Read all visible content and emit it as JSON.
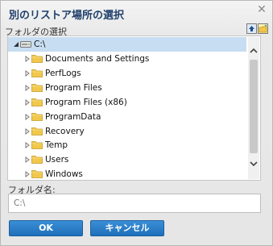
{
  "dialog": {
    "title": "別のリストア場所の選択",
    "folder_select_label": "フォルダの選択",
    "folder_name_label": "フォルダ名:",
    "folder_name_placeholder": "C:\\",
    "ok_label": "OK",
    "cancel_label": "キャンセル"
  },
  "tree": {
    "root": {
      "label": "C:\\",
      "icon": "drive-icon",
      "expanded": true,
      "selected": true
    },
    "children": [
      {
        "label": "Documents and Settings"
      },
      {
        "label": "PerfLogs"
      },
      {
        "label": "Program Files"
      },
      {
        "label": "Program Files (x86)"
      },
      {
        "label": "ProgramData"
      },
      {
        "label": "Recovery"
      },
      {
        "label": "Temp"
      },
      {
        "label": "Users"
      },
      {
        "label": "Windows"
      }
    ]
  },
  "colors": {
    "title": "#1f3f6b",
    "selection": "#c7ddf2",
    "button": "#2a7fcc",
    "folder": "#f1c84b"
  }
}
